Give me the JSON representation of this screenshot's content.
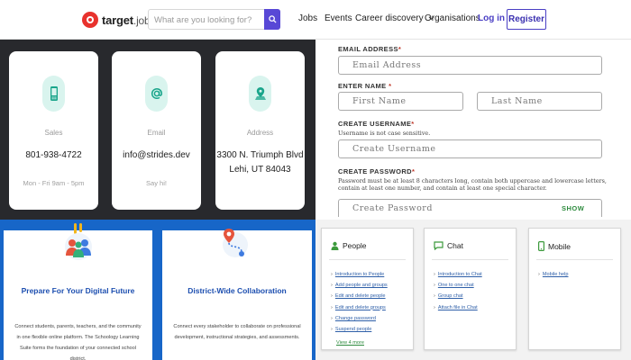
{
  "nav": {
    "logo_text": "target",
    "logo_suffix": "jobs",
    "search_placeholder": "What are you looking for?",
    "links": [
      "Jobs",
      "Events",
      "Career discovery",
      "Organisations"
    ],
    "login": "Log in",
    "register": "Register",
    "accent_color": "#4a3fc4"
  },
  "contacts": [
    {
      "label": "Sales",
      "value": "801-938-4722",
      "sub": "Mon - Fri 9am - 5pm",
      "icon": "phone-icon"
    },
    {
      "label": "Email",
      "value": "info@strides.dev",
      "sub": "Say hi!",
      "icon": "at-sign-icon"
    },
    {
      "label": "Address",
      "value_line1": "3300 N. Triumph Blvd",
      "value_line2": "Lehi, UT 84043",
      "icon": "map-marker-icon"
    }
  ],
  "features": [
    {
      "title": "Prepare For Your Digital Future",
      "desc": "Connect students, parents, teachers, and the community in one flexible online platform. The Schoology Learning Suite forms the foundation of your connected school district.",
      "icon": "people-group-icon"
    },
    {
      "title": "District-Wide Collaboration",
      "desc": "Connect every stakeholder to collaborate on professional development, instructional strategies, and assessments.",
      "icon": "route-pin-icon"
    }
  ],
  "form": {
    "email_label": "EMAIL ADDRESS",
    "email_placeholder": "Email Address",
    "name_label": "ENTER NAME",
    "first_placeholder": "First Name",
    "last_placeholder": "Last Name",
    "username_label": "CREATE USERNAME",
    "username_hint": "Username is not case sensitive.",
    "username_placeholder": "Create Username",
    "password_label": "CREATE PASSWORD",
    "password_hint": "Password must be at least 8 characters long, contain both uppercase and lowercase letters, contain at least one number, and contain at least one special character.",
    "password_placeholder": "Create Password",
    "show": "SHOW",
    "required_marker": "*"
  },
  "help": [
    {
      "title": "People",
      "icon": "person-icon",
      "items": [
        "Introduction to People",
        "Add people and groups",
        "Edit and delete people",
        "Edit and delete groups",
        "Change password",
        "Suspend people"
      ],
      "more": "View 4 more"
    },
    {
      "title": "Chat",
      "icon": "chat-bubble-icon",
      "items": [
        "Introduction to Chat",
        "One to one chat",
        "Group chat",
        "Attach file in Chat"
      ]
    },
    {
      "title": "Mobile",
      "icon": "mobile-icon",
      "items": [
        "Mobile help"
      ]
    }
  ]
}
